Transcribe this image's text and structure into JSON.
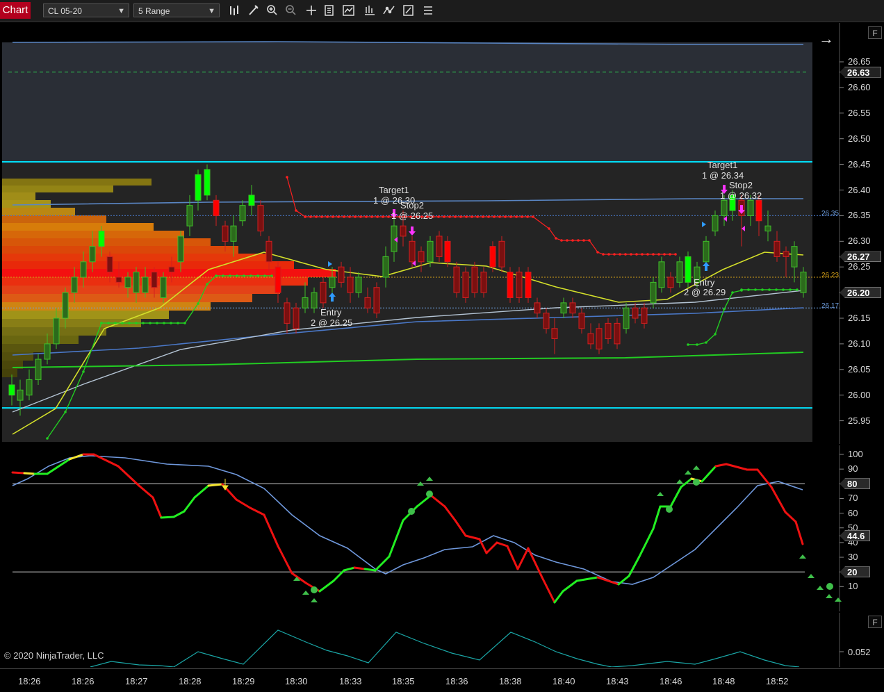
{
  "toolbar": {
    "tab_label": "Chart",
    "instrument": "CL 05-20",
    "period": "5 Range",
    "icons": [
      "bars-type-icon",
      "pencil-icon",
      "zoom-in-icon",
      "zoom-out-icon",
      "crosshair-icon",
      "properties-icon",
      "data-series-icon",
      "indicators-icon",
      "strategies-icon",
      "menu-lines-icon"
    ]
  },
  "price_axis": {
    "ticks": [
      "26.65",
      "26.60",
      "26.55",
      "26.50",
      "26.45",
      "26.40",
      "26.35",
      "26.30",
      "26.25",
      "26.20",
      "26.15",
      "26.10",
      "26.05",
      "26.00",
      "25.95"
    ],
    "tags": [
      {
        "text": "26.63",
        "bg": "#222222",
        "fg": "#ffffff"
      },
      {
        "text": "26.27",
        "bg": "#2a2a2a",
        "fg": "#ffffff"
      },
      {
        "text": "26.20",
        "bg": "#2a2a2a",
        "fg": "#ffffff"
      }
    ],
    "inline_labels": [
      {
        "text": "26.35",
        "color": "#6f9fe0"
      },
      {
        "text": "26.23",
        "color": "#d4a017"
      },
      {
        "text": "26.17",
        "color": "#6f9fe0"
      }
    ]
  },
  "annotations": {
    "target_left_title": "Target1",
    "target_left_fill": "1 @ 26.30",
    "stop_left_title": "Stop2",
    "stop_left_fill": "1 @ 26.25",
    "entry_left_title": "Entry",
    "entry_left_fill": "2 @ 26.25",
    "target_right_title": "Target1",
    "target_right_fill": "1 @ 26.34",
    "stop_right_title": "Stop2",
    "stop_right_fill": "1 @ 26.32",
    "entry_right_title": "Entry",
    "entry_right_fill": "2 @ 26.29"
  },
  "oscillator": {
    "ticks": [
      "100",
      "90",
      "80",
      "70",
      "60",
      "50",
      "40",
      "30",
      "20",
      "10"
    ],
    "tags": [
      {
        "text": "80",
        "bg": "#2a2a2a",
        "fg": "#ffffff"
      },
      {
        "text": "44.6",
        "bg": "#2a2a2a",
        "fg": "#ffffff"
      },
      {
        "text": "20",
        "bg": "#2a2a2a",
        "fg": "#ffffff"
      }
    ]
  },
  "lower_indicator": {
    "ticks": [
      "0.052"
    ],
    "button": "F"
  },
  "top_button": "F",
  "nav_arrow": "→",
  "copyright": "© 2020 NinjaTrader, LLC",
  "time_axis": [
    "18:26",
    "18:26",
    "18:27",
    "18:28",
    "18:29",
    "18:30",
    "18:33",
    "18:35",
    "18:36",
    "18:38",
    "18:40",
    "18:43",
    "18:46",
    "18:48",
    "18:52"
  ],
  "colors": {
    "up": "#22dd22",
    "down": "#ee1111",
    "cyan_level": "#00e5ff",
    "ema_yellow": "#d4e02a",
    "ma_blue": "#4a78c8",
    "stop_red_dots": "#ff2020",
    "trail_green": "#22cc22"
  }
}
